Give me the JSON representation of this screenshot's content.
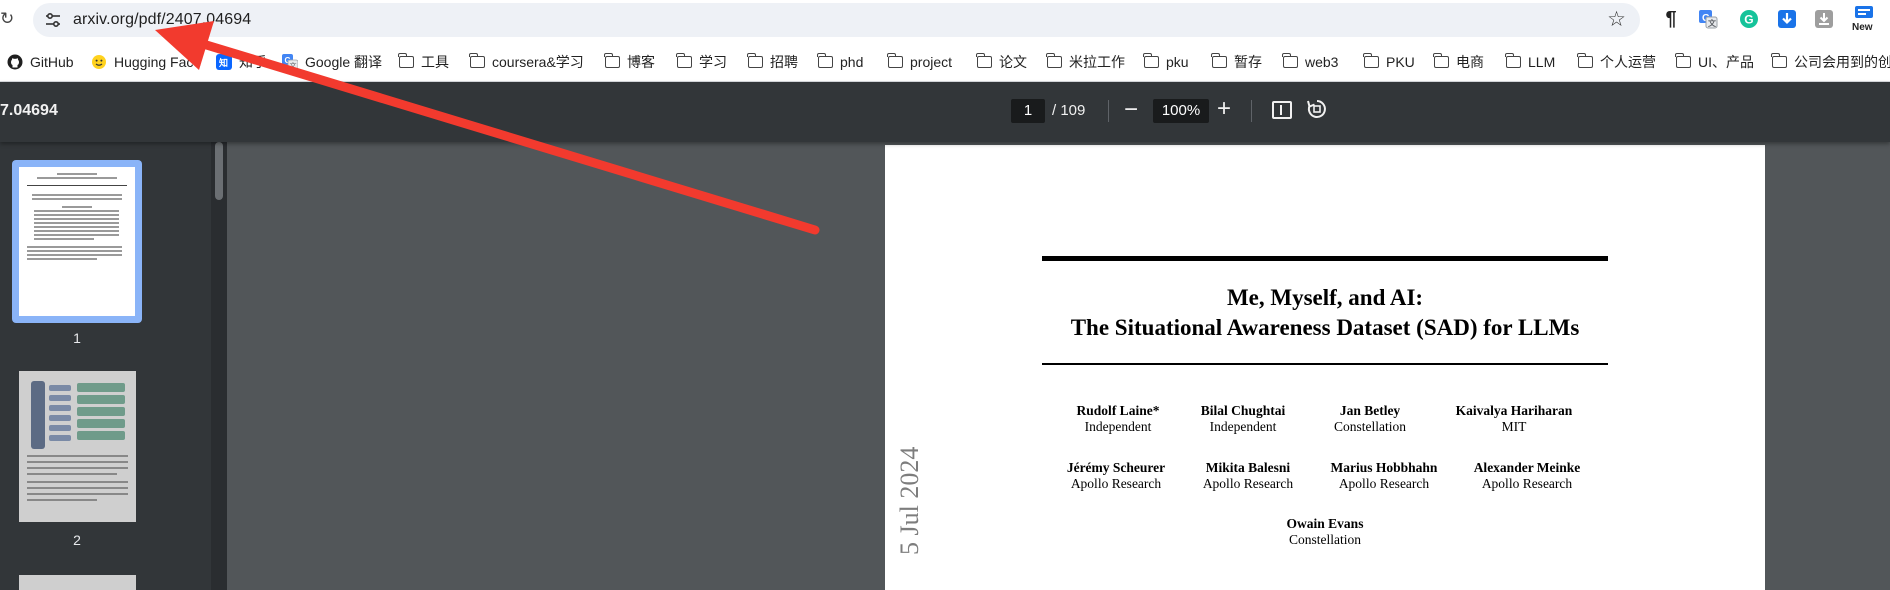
{
  "browser": {
    "url": "arxiv.org/pdf/2407.04694",
    "icons": {
      "reload": "reload-icon",
      "site_info": "tune-icon",
      "bookmark": "star-icon"
    },
    "extensions": [
      {
        "name": "pilcrow-icon",
        "glyph": "¶"
      },
      {
        "name": "translate-icon",
        "glyph": "G"
      },
      {
        "name": "grammarly-icon",
        "glyph": "G"
      },
      {
        "name": "download-icon",
        "glyph": "⬇"
      },
      {
        "name": "download-manager-icon",
        "glyph": "⬇"
      },
      {
        "name": "new-badge-icon",
        "glyph": "New"
      }
    ]
  },
  "bookmarks": [
    {
      "label": "GitHub",
      "icon": "github-icon"
    },
    {
      "label": "Hugging Face",
      "icon": "hugging-face-icon"
    },
    {
      "label": "知乎",
      "icon": "zhihu-icon"
    },
    {
      "label": "Google 翻译",
      "icon": "google-translate-icon"
    },
    {
      "label": "工具",
      "icon": "folder-icon"
    },
    {
      "label": "coursera&学习",
      "icon": "folder-icon"
    },
    {
      "label": "博客",
      "icon": "folder-icon"
    },
    {
      "label": "学习",
      "icon": "folder-icon"
    },
    {
      "label": "招聘",
      "icon": "folder-icon"
    },
    {
      "label": "phd",
      "icon": "folder-icon"
    },
    {
      "label": "project",
      "icon": "folder-icon"
    },
    {
      "label": "论文",
      "icon": "folder-icon"
    },
    {
      "label": "米拉工作",
      "icon": "folder-icon"
    },
    {
      "label": "pku",
      "icon": "folder-icon"
    },
    {
      "label": "暂存",
      "icon": "folder-icon"
    },
    {
      "label": "web3",
      "icon": "folder-icon"
    },
    {
      "label": "PKU",
      "icon": "folder-icon"
    },
    {
      "label": "电商",
      "icon": "folder-icon"
    },
    {
      "label": "LLM",
      "icon": "folder-icon"
    },
    {
      "label": "个人运营",
      "icon": "folder-icon"
    },
    {
      "label": "UI、产品",
      "icon": "folder-icon"
    },
    {
      "label": "公司会用到的创",
      "icon": "folder-icon"
    }
  ],
  "pdf_toolbar": {
    "title": "7.04694",
    "current_page": "1",
    "total_pages": "/ 109",
    "zoom": "100%",
    "icons": [
      "zoom-out-icon",
      "zoom-in-icon",
      "fit-page-icon",
      "rotate-icon"
    ]
  },
  "sidebar": {
    "thumbnails": [
      {
        "label": "1",
        "selected": true
      },
      {
        "label": "2",
        "selected": false
      }
    ]
  },
  "paper": {
    "title_line1": "Me, Myself, and AI:",
    "title_line2": "The Situational Awareness Dataset (SAD) for LLMs",
    "authors": [
      {
        "name": "Rudolf Laine*",
        "affiliation": "Independent"
      },
      {
        "name": "Bilal Chughtai",
        "affiliation": "Independent"
      },
      {
        "name": "Jan Betley",
        "affiliation": "Constellation"
      },
      {
        "name": "Kaivalya Hariharan",
        "affiliation": "MIT"
      },
      {
        "name": "Jérémy Scheurer",
        "affiliation": "Apollo Research"
      },
      {
        "name": "Mikita Balesni",
        "affiliation": "Apollo Research"
      },
      {
        "name": "Marius Hobbhahn",
        "affiliation": "Apollo Research"
      },
      {
        "name": "Alexander Meinke",
        "affiliation": "Apollo Research"
      },
      {
        "name": "Owain Evans",
        "affiliation": "Constellation"
      }
    ],
    "arxiv_stamp": "5 Jul 2024"
  },
  "annotation": {
    "arrow_color": "#f23a2e"
  }
}
